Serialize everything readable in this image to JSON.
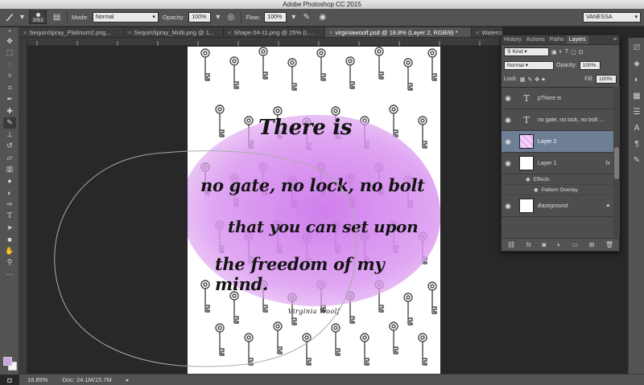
{
  "app": {
    "title": "Adobe Photoshop CC 2015"
  },
  "options": {
    "brush_size": "3053",
    "mode_label": "Mode:",
    "mode_value": "Normal",
    "opacity_label": "Opacity:",
    "opacity_value": "100%",
    "flow_label": "Flow:",
    "flow_value": "100%",
    "workspace": "VANESSA"
  },
  "tabs": [
    {
      "label": "SequinSpray_Platinum2.png..."
    },
    {
      "label": "SequinSpray_Multi.png @ 1..."
    },
    {
      "label": "Shape 04-11.png @ 25% (L..."
    },
    {
      "label": "virginiawoolf.psd @ 18.8% (Layer 2, RGB/8) *"
    },
    {
      "label": "Watercolor Splash Preset.png..."
    }
  ],
  "document": {
    "quote_line1": "There is",
    "quote_line2": "no gate, no lock, no bolt",
    "quote_line3": "that you can set upon",
    "quote_line4": "the freedom of my mind.",
    "author": "Virginia Woolf"
  },
  "status": {
    "zoom": "18.85%",
    "doc": "Doc: 24.1M/15.7M"
  },
  "panel": {
    "tabs": [
      "History",
      "Actions",
      "Paths",
      "Layers"
    ],
    "filter_kind": "Kind",
    "blend_mode": "Normal",
    "opacity_label": "Opacity:",
    "opacity_value": "100%",
    "lock_label": "Lock:",
    "fill_label": "Fill:",
    "fill_value": "100%",
    "layers": [
      {
        "name": "pThere is"
      },
      {
        "name": "no gate, no lock, no bolt ..."
      },
      {
        "name": "Layer 2"
      },
      {
        "name": "Layer 1",
        "fx": "fx"
      },
      {
        "name": "Background"
      }
    ],
    "effects_label": "Effects",
    "pattern_overlay": "Pattern Overlay"
  },
  "colors": {
    "foreground": "#c8a7e3",
    "background": "#f7f2fb",
    "selected_layer": "#6d7e95"
  }
}
